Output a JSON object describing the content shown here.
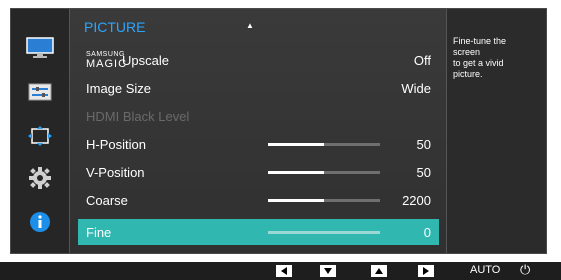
{
  "sidebar": {
    "icons": [
      "monitor-icon",
      "sliders-icon",
      "resize-arrows-icon",
      "gear-icon",
      "info-icon"
    ],
    "colors": {
      "accent": "#2aa6ff"
    }
  },
  "menu": {
    "title": "PICTURE",
    "rows": [
      {
        "label_small": "SAMSUNG",
        "label_big": "MAGIC",
        "label_rest": "Upscale",
        "value": "Off",
        "enabled": true
      },
      {
        "label": "Image Size",
        "value": "Wide",
        "enabled": true
      },
      {
        "label": "HDMI Black Level",
        "value": "",
        "enabled": false
      },
      {
        "label": "H-Position",
        "value": "50",
        "level": 0.5,
        "enabled": true
      },
      {
        "label": "V-Position",
        "value": "50",
        "level": 0.5,
        "enabled": true
      },
      {
        "label": "Coarse",
        "value": "2200",
        "level": 0.5,
        "enabled": true
      },
      {
        "label": "Fine",
        "value": "0",
        "level": 0,
        "enabled": true,
        "selected": true
      }
    ]
  },
  "help": {
    "line1": "Fine-tune the",
    "line2": "screen",
    "line3": "to get a vivid",
    "line4": "picture."
  },
  "bottom": {
    "auto_label": "AUTO",
    "power_symbol": "⏻",
    "buttons": [
      "left-arrow-button",
      "down-arrow-button",
      "up-arrow-button",
      "right-arrow-button"
    ]
  },
  "colors": {
    "selected_row": "#2fb7b0",
    "panel": "#2b2b2b"
  }
}
